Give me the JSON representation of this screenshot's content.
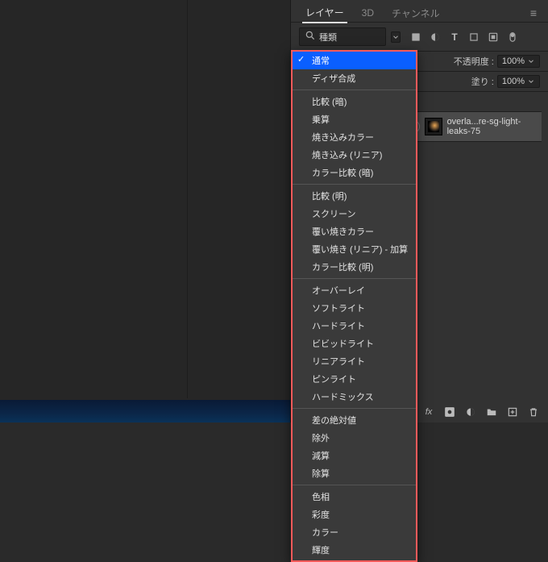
{
  "tabs": {
    "layers": "レイヤー",
    "threeD": "3D",
    "channels": "チャンネル"
  },
  "filter": {
    "placeholder": "種類"
  },
  "blend": {
    "opacity_label": "不透明度 :",
    "opacity_value": "100%",
    "fill_label": "塗り :",
    "fill_value": "100%"
  },
  "layer1": {
    "name": "overla...re-sg-light-leaks-75"
  },
  "blend_menu": {
    "groups": [
      {
        "items": [
          "通常",
          "ディザ合成"
        ],
        "selected": 0
      },
      {
        "items": [
          "比較 (暗)",
          "乗算",
          "焼き込みカラー",
          "焼き込み (リニア)",
          "カラー比較 (暗)"
        ]
      },
      {
        "items": [
          "比較 (明)",
          "スクリーン",
          "覆い焼きカラー",
          "覆い焼き (リニア) - 加算",
          "カラー比較 (明)"
        ]
      },
      {
        "items": [
          "オーバーレイ",
          "ソフトライト",
          "ハードライト",
          "ビビッドライト",
          "リニアライト",
          "ピンライト",
          "ハードミックス"
        ]
      },
      {
        "items": [
          "差の絶対値",
          "除外",
          "減算",
          "除算"
        ]
      },
      {
        "items": [
          "色相",
          "彩度",
          "カラー",
          "輝度"
        ]
      }
    ]
  }
}
